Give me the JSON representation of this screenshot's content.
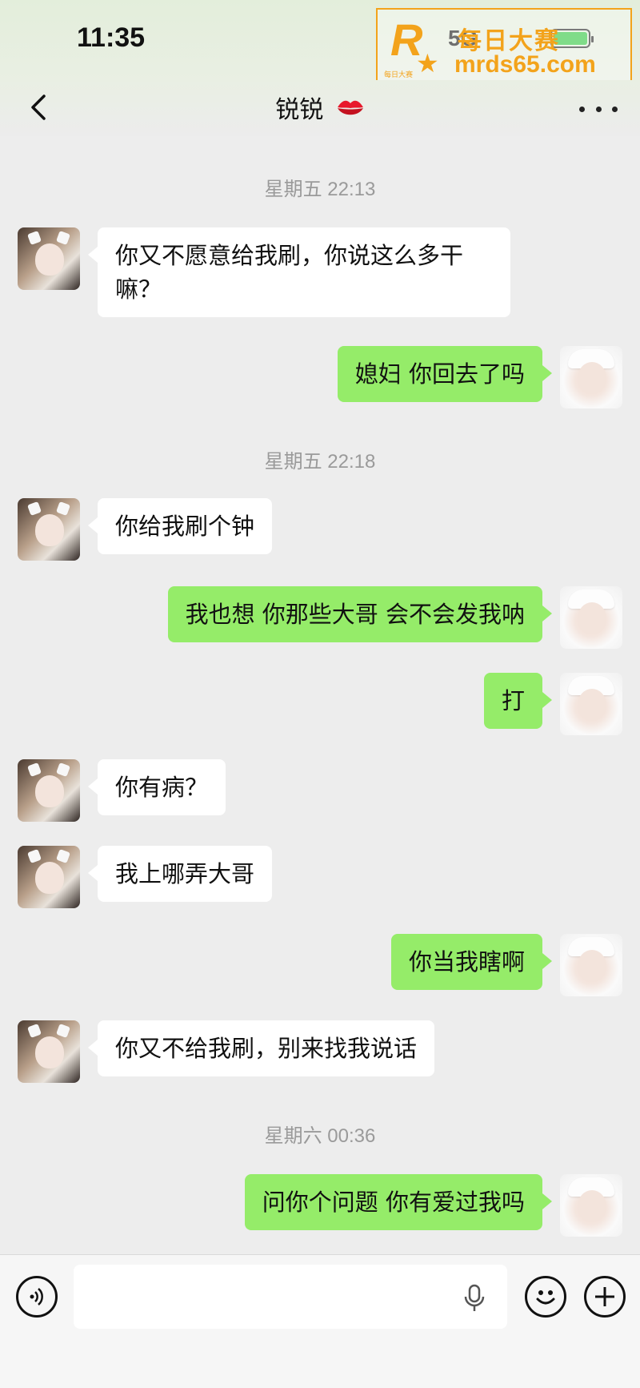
{
  "status_bar": {
    "time": "11:35",
    "network": "5G"
  },
  "watermark": {
    "logo_letter": "R",
    "small_text": "每日大赛",
    "title": "每日大赛",
    "url": "mrds65.com"
  },
  "header": {
    "title": "锐锐"
  },
  "messages": [
    {
      "type": "timestamp",
      "text": "星期五 22:13"
    },
    {
      "type": "message",
      "side": "left",
      "text": "你又不愿意给我刷，你说这么多干嘛？"
    },
    {
      "type": "message",
      "side": "right",
      "text": "媳妇 你回去了吗"
    },
    {
      "type": "timestamp",
      "text": "星期五 22:18"
    },
    {
      "type": "message",
      "side": "left",
      "text": "你给我刷个钟"
    },
    {
      "type": "message",
      "side": "right",
      "text": "我也想 你那些大哥 会不会发我呐"
    },
    {
      "type": "message",
      "side": "right",
      "text": "打"
    },
    {
      "type": "message",
      "side": "left",
      "text": "你有病？"
    },
    {
      "type": "message",
      "side": "left",
      "text": "我上哪弄大哥"
    },
    {
      "type": "message",
      "side": "right",
      "text": "你当我瞎啊"
    },
    {
      "type": "message",
      "side": "left",
      "text": "你又不给我刷，别来找我说话"
    },
    {
      "type": "timestamp",
      "text": "星期六 00:36"
    },
    {
      "type": "message",
      "side": "right",
      "text": "问你个问题 你有爱过我吗"
    }
  ],
  "input": {
    "value": "",
    "placeholder": ""
  },
  "colors": {
    "self_bubble": "#95ec69",
    "other_bubble": "#ffffff",
    "background": "#ededed",
    "timestamp": "#9a9a9a"
  }
}
